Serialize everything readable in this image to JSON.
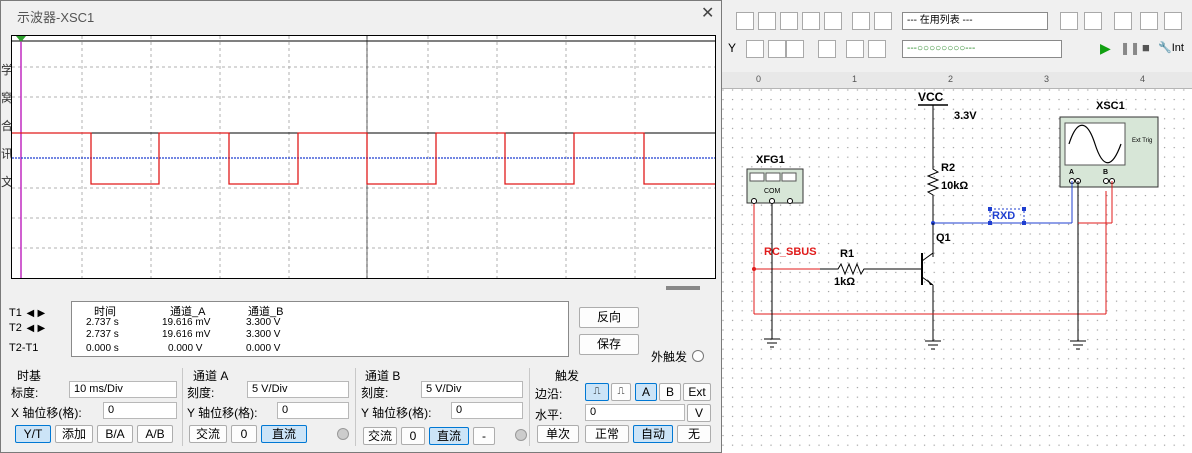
{
  "scope": {
    "title": "示波器-XSC1",
    "close_glyph": "✕",
    "cursors": {
      "t1": "T1",
      "t2": "T2",
      "t2t1": "T2-T1"
    },
    "readout": {
      "headers": [
        "时间",
        "通道_A",
        "通道_B"
      ],
      "rows": [
        [
          "2.737 s",
          "19.616 mV",
          "3.300 V"
        ],
        [
          "2.737 s",
          "19.616 mV",
          "3.300 V"
        ],
        [
          "0.000 s",
          "0.000 V",
          "0.000 V"
        ]
      ]
    },
    "buttons": {
      "reverse": "反向",
      "save": "保存",
      "ext_trigger": "外触发"
    },
    "timebase": {
      "title": "时基",
      "scale_label": "标度:",
      "scale_value": "10 ms/Div",
      "xpos_label": "X 轴位移(格):",
      "xpos_value": "0",
      "modes": [
        "Y/T",
        "添加",
        "B/A",
        "A/B"
      ],
      "selected_mode": "Y/T"
    },
    "channel_a": {
      "title": "通道 A",
      "scale_label": "刻度:",
      "scale_value": "5  V/Div",
      "ypos_label": "Y 轴位移(格):",
      "ypos_value": "0",
      "coupling": [
        "交流",
        "0",
        "直流"
      ],
      "selected": "直流"
    },
    "channel_b": {
      "title": "通道 B",
      "scale_label": "刻度:",
      "scale_value": "5  V/Div",
      "ypos_label": "Y 轴位移(格):",
      "ypos_value": "0",
      "coupling": [
        "交流",
        "0",
        "直流",
        "-"
      ],
      "selected": "直流"
    },
    "trigger": {
      "title": "触发",
      "edge_label": "边沿:",
      "edge_buttons": [
        "A",
        "B",
        "Ext"
      ],
      "selected_source": "A",
      "level_label": "水平:",
      "level_value": "0",
      "level_unit": "V",
      "modes": [
        "单次",
        "正常",
        "自动",
        "无"
      ],
      "selected_mode": "自动"
    },
    "trace_colors": {
      "channel_a": "#1f3fd0",
      "channel_b": "#e01b1b",
      "grid": "#b0b0b0"
    }
  },
  "workspace": {
    "toolbar_dropdown": "--- 在用列表 ---",
    "toolbar_dropdown2": "---○○○○○○○○---",
    "toolbar_run_text": "Int",
    "ruler": [
      "0",
      "1",
      "2",
      "3",
      "4"
    ],
    "schematic": {
      "vcc_label": "VCC",
      "vcc_value": "3.3V",
      "r2_name": "R2",
      "r2_value": "10kΩ",
      "q1_name": "Q1",
      "r1_name": "R1",
      "r1_value": "1kΩ",
      "net_rc": "RC_SBUS",
      "net_rxd": "RXD",
      "xfg_name": "XFG1",
      "xfg_com": "COM",
      "xsc_name": "XSC1",
      "xsc_ext": "Ext Trig",
      "xsc_a": "A",
      "xsc_b": "B"
    }
  },
  "left_edge_chars": [
    "学",
    "窝",
    "合",
    "讯",
    "文"
  ]
}
